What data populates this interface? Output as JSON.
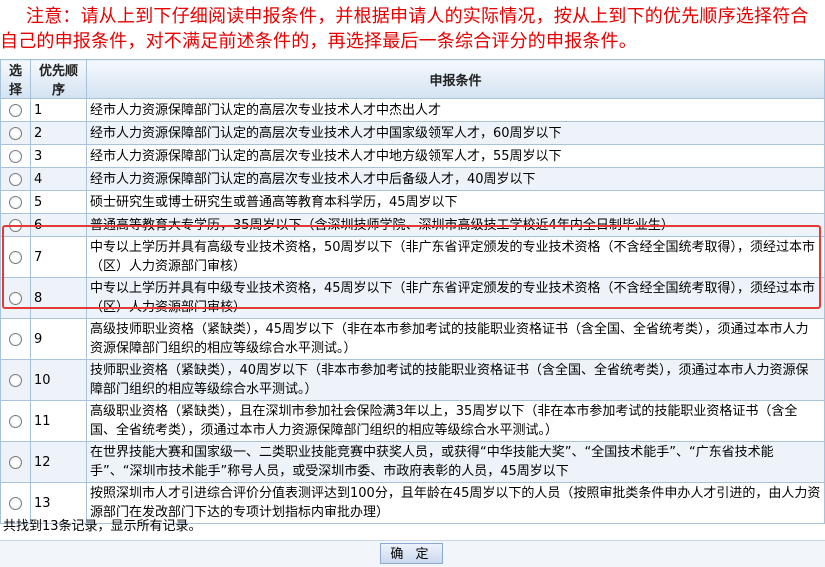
{
  "notice": "注意：请从上到下仔细阅读申报条件，并根据申请人的实际情况，按从上到下的优先顺序选择符合自己的申报条件，对不满足前述条件的，再选择最后一条综合评分的申报条件。",
  "table": {
    "headers": {
      "select": "选择",
      "priority": "优先顺序",
      "condition": "申报条件"
    },
    "rows": [
      {
        "num": "1",
        "text": "经市人力资源保障部门认定的高层次专业技术人才中杰出人才"
      },
      {
        "num": "2",
        "text": "经市人力资源保障部门认定的高层次专业技术人才中国家级领军人才，60周岁以下"
      },
      {
        "num": "3",
        "text": "经市人力资源保障部门认定的高层次专业技术人才中地方级领军人才，55周岁以下"
      },
      {
        "num": "4",
        "text": "经市人力资源保障部门认定的高层次专业技术人才中后备级人才，40周岁以下"
      },
      {
        "num": "5",
        "text": "硕士研究生或博士研究生或普通高等教育本科学历，45周岁以下"
      },
      {
        "num": "6",
        "text": "普通高等教育大专学历，35周岁以下（含深圳技师学院、深圳市高级技工学校近4年内全日制毕业生）"
      },
      {
        "num": "7",
        "text": "中专以上学历并具有高级专业技术资格，50周岁以下（非广东省评定颁发的专业技术资格（不含经全国统考取得），须经过本市（区）人力资源部门审核）"
      },
      {
        "num": "8",
        "text": "中专以上学历并具有中级专业技术资格，45周岁以下（非广东省评定颁发的专业技术资格（不含经全国统考取得），须经过本市（区）人力资源部门审核）"
      },
      {
        "num": "9",
        "text": "高级技师职业资格（紧缺类），45周岁以下（非在本市参加考试的技能职业资格证书（含全国、全省统考类），须通过本市人力资源保障部门组织的相应等级综合水平测试。）"
      },
      {
        "num": "10",
        "text": "技师职业资格（紧缺类），40周岁以下（非本市参加考试的技能职业资格证书（含全国、全省统考类），须通过本市人力资源保障部门组织的相应等级综合水平测试。）"
      },
      {
        "num": "11",
        "text": "高级职业资格（紧缺类），且在深圳市参加社会保险满3年以上，35周岁以下（非在本市参加考试的技能职业资格证书（含全国、全省统考类），须通过本市人力资源保障部门组织的相应等级综合水平测试。）"
      },
      {
        "num": "12",
        "text": "在世界技能大赛和国家级一、二类职业技能竞赛中获奖人员，或获得“中华技能大奖”、“全国技术能手”、“广东省技术能手”、“深圳市技术能手”称号人员，或受深圳市委、市政府表彰的人员，45周岁以下"
      },
      {
        "num": "13",
        "text": "按照深圳市人才引进综合评价分值表测评达到100分，且年龄在45周岁以下的人员（按照审批类条件申办人才引进的，由人力资源部门在发改部门下达的专项计划指标内审批办理）"
      }
    ]
  },
  "footer": {
    "status": "共找到13条记录，显示所有记录。",
    "confirm_label": "确 定"
  }
}
